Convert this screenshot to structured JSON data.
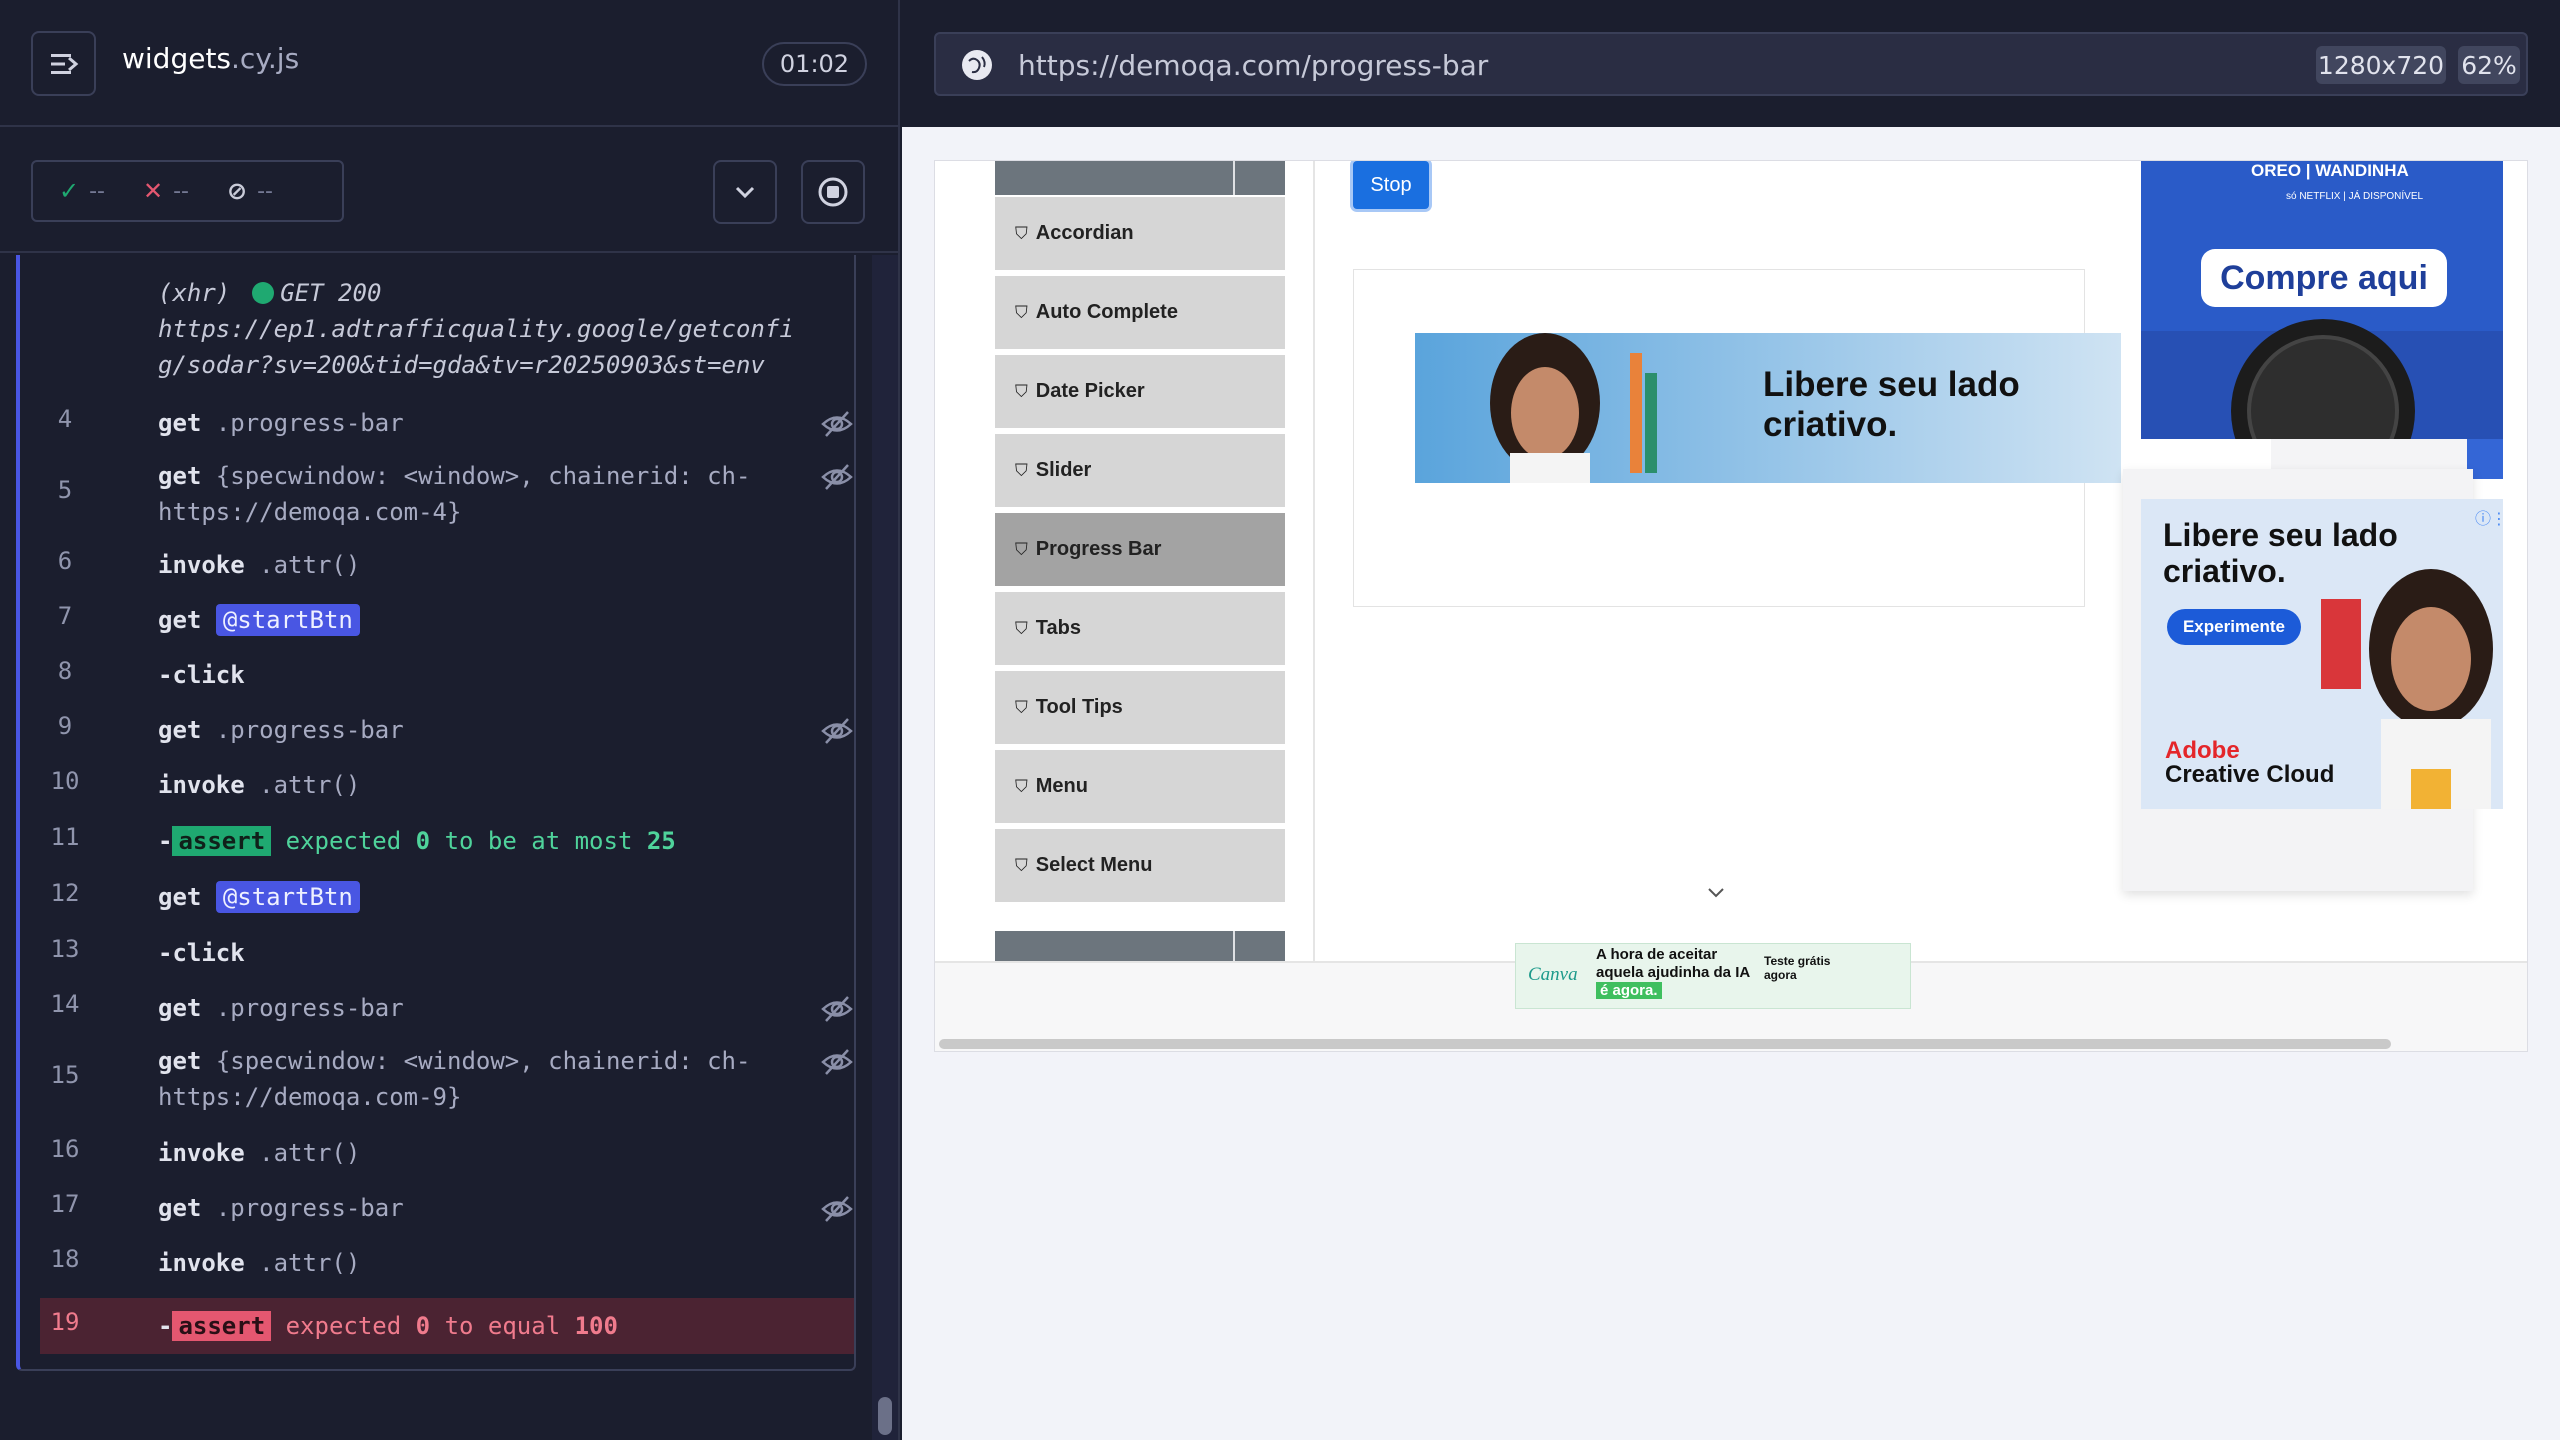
{
  "reporter": {
    "spec_base": "widgets",
    "spec_ext": ".cy.js",
    "timer": "01:02",
    "stats": {
      "passed": "--",
      "failed": "--",
      "pending": "--"
    },
    "xhr": {
      "label": "(xhr)",
      "status": "GET 200",
      "url": "https://ep1.adtrafficquality.google/getconfig/sodar?sv=200&tid=gda&tv=r20250903&st=env"
    },
    "commands": [
      {
        "num": "4",
        "name": "get",
        "msg": ".progress-bar"
      },
      {
        "num": "5",
        "name": "get",
        "msg": "{specwindow: <window>, chainerid: ch-https://demoqa.com-4}"
      },
      {
        "num": "6",
        "name": "invoke",
        "msg": ".attr()"
      },
      {
        "num": "7",
        "name": "get",
        "alias": "@startBtn"
      },
      {
        "num": "8",
        "name": "-click"
      },
      {
        "num": "9",
        "name": "get",
        "msg": ".progress-bar"
      },
      {
        "num": "10",
        "name": "invoke",
        "msg": ".attr()"
      },
      {
        "num": "11",
        "name": "-",
        "assert_label": "assert",
        "assert_msg": "expected",
        "v1": "0",
        "mid": "to be at most",
        "v2": "25"
      },
      {
        "num": "12",
        "name": "get",
        "alias": "@startBtn"
      },
      {
        "num": "13",
        "name": "-click"
      },
      {
        "num": "14",
        "name": "get",
        "msg": ".progress-bar"
      },
      {
        "num": "15",
        "name": "get",
        "msg": "{specwindow: <window>, chainerid: ch-https://demoqa.com-9}"
      },
      {
        "num": "16",
        "name": "invoke",
        "msg": ".attr()"
      },
      {
        "num": "17",
        "name": "get",
        "msg": ".progress-bar"
      },
      {
        "num": "18",
        "name": "invoke",
        "msg": ".attr()"
      },
      {
        "num": "19",
        "name": "-",
        "assert_label": "assert",
        "assert_msg": "expected",
        "v1": "0",
        "mid": "to equal",
        "v2": "100"
      }
    ]
  },
  "aut": {
    "url": "https://demoqa.com/progress-bar",
    "viewport": "1280x720",
    "zoom": "62%",
    "sidebar": [
      "Accordian",
      "Auto Complete",
      "Date Picker",
      "Slider",
      "Progress Bar",
      "Tabs",
      "Tool Tips",
      "Menu",
      "Select Menu"
    ],
    "active_item": "Progress Bar",
    "stop_label": "Stop",
    "ads": {
      "canva_banner": "Libere seu lado criativo.",
      "oreo_brand": "OREO | WANDINHA",
      "oreo_small": "só NETFLIX | JÁ DISPONÍVEL",
      "oreo_cta": "Compre aqui",
      "adobe_headline": "Libere seu lado criativo.",
      "adobe_cta": "Experimente",
      "adobe_brand1": "Adobe",
      "adobe_brand2": "Creative Cloud",
      "bottom_logo": "Canva",
      "bottom_text": "A hora de aceitar aquela ajudinha da IA",
      "bottom_highlight": "é agora.",
      "bottom_cta1": "Teste grátis",
      "bottom_cta2": "agora"
    }
  }
}
